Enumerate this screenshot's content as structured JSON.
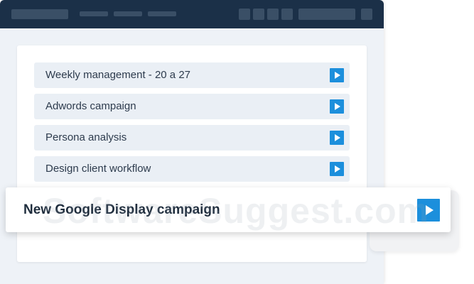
{
  "tasks": [
    {
      "label": "Weekly management - 20 a 27",
      "icon": "play-icon"
    },
    {
      "label": "Adwords campaign",
      "icon": "play-icon"
    },
    {
      "label": "Persona analysis",
      "icon": "play-icon"
    },
    {
      "label": "Design client workflow",
      "icon": "play-icon"
    }
  ],
  "featured_task": {
    "label": "New Google Display campaign",
    "icon": "play-icon"
  },
  "watermark": "SoftwareSuggest.com",
  "colors": {
    "topbar": "#1b3048",
    "accent": "#1c8fdc",
    "task_bg": "#eaeff5",
    "window_bg": "#eef2f7"
  }
}
